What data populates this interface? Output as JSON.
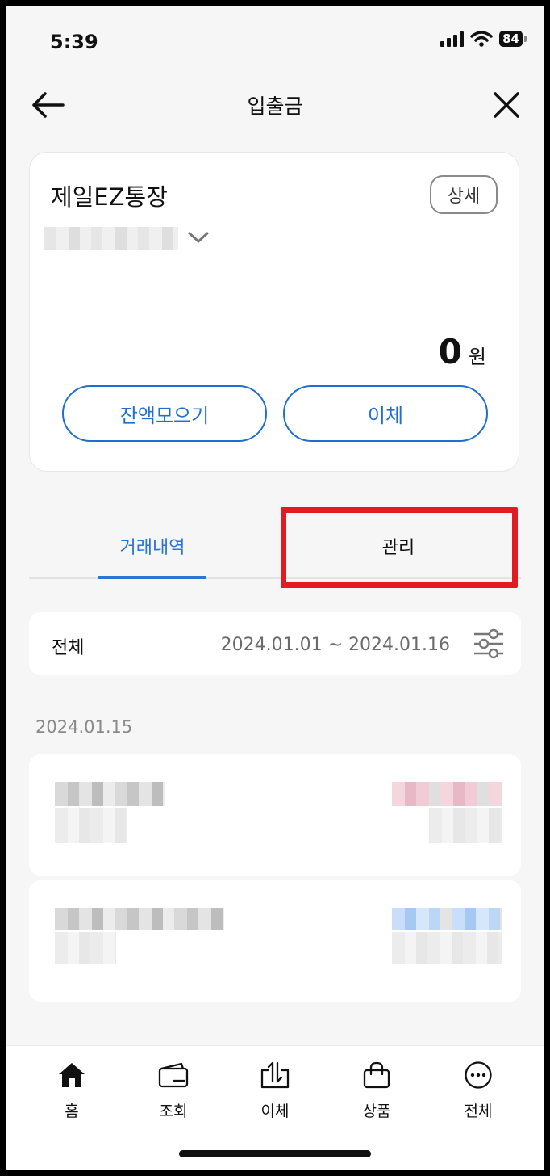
{
  "status": {
    "time": "5:39",
    "battery": "84"
  },
  "header": {
    "title": "입출금"
  },
  "account": {
    "name": "제일EZ통장",
    "detail_label": "상세",
    "balance": "0",
    "unit": "원",
    "actions": [
      {
        "label": "잔액모으기"
      },
      {
        "label": "이체"
      }
    ]
  },
  "tabs": [
    {
      "label": "거래내역",
      "active": true
    },
    {
      "label": "관리",
      "active": false
    }
  ],
  "filter": {
    "type": "전체",
    "range": "2024.01.01 ~ 2024.01.16"
  },
  "transactions": {
    "date": "2024.01.15"
  },
  "nav": [
    {
      "label": "홈",
      "icon": "home-icon"
    },
    {
      "label": "조회",
      "icon": "wallet-icon"
    },
    {
      "label": "이체",
      "icon": "transfer-icon"
    },
    {
      "label": "상품",
      "icon": "shopping-bag-icon"
    },
    {
      "label": "전체",
      "icon": "more-icon"
    }
  ],
  "colors": {
    "accent": "#2e73d6",
    "highlight": "#e11b22"
  }
}
